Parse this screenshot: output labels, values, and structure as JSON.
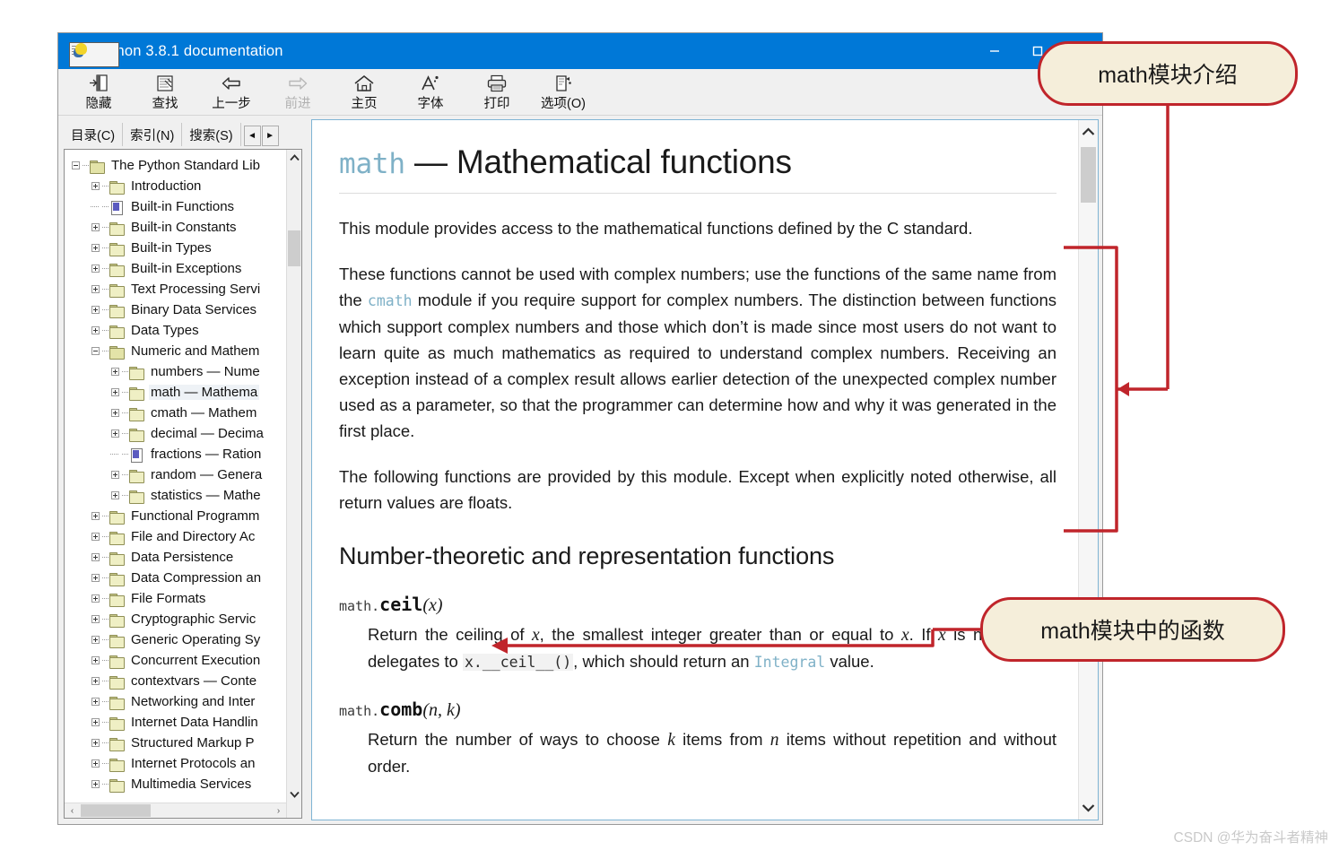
{
  "window": {
    "title": "Python 3.8.1 documentation",
    "icon": "chm-help-icon",
    "controls": {
      "minimize": "–",
      "maximize": "□"
    }
  },
  "toolbar": {
    "items": [
      {
        "label": "隐藏",
        "icon": "hide-pane-icon",
        "disabled": false
      },
      {
        "label": "查找",
        "icon": "search-icon",
        "disabled": false
      },
      {
        "label": "上一步",
        "icon": "back-arrow-icon",
        "disabled": false
      },
      {
        "label": "前进",
        "icon": "forward-arrow-icon",
        "disabled": true
      },
      {
        "label": "主页",
        "icon": "home-icon",
        "disabled": false
      },
      {
        "label": "字体",
        "icon": "font-icon",
        "disabled": false
      },
      {
        "label": "打印",
        "icon": "print-icon",
        "disabled": false
      },
      {
        "label": "选项(O)",
        "icon": "options-icon",
        "disabled": false
      }
    ]
  },
  "sidebar": {
    "tabs": [
      {
        "label": "目录(C)",
        "active": true
      },
      {
        "label": "索引(N)",
        "active": false
      },
      {
        "label": "搜索(S)",
        "active": false
      }
    ],
    "nav_prev": "◄",
    "nav_next": "►",
    "hscroll_prev": "‹",
    "hscroll_next": "›",
    "tree": [
      {
        "label": "The Python Standard Lib",
        "depth": 0,
        "icon": "folder-open-icon",
        "expander": "minus",
        "selected": false
      },
      {
        "label": "Introduction",
        "depth": 1,
        "icon": "folder-icon",
        "expander": "plus",
        "selected": false
      },
      {
        "label": "Built-in Functions",
        "depth": 1,
        "icon": "page-icon",
        "expander": "none",
        "selected": false
      },
      {
        "label": "Built-in Constants",
        "depth": 1,
        "icon": "folder-icon",
        "expander": "plus",
        "selected": false
      },
      {
        "label": "Built-in Types",
        "depth": 1,
        "icon": "folder-icon",
        "expander": "plus",
        "selected": false
      },
      {
        "label": "Built-in Exceptions",
        "depth": 1,
        "icon": "folder-icon",
        "expander": "plus",
        "selected": false
      },
      {
        "label": "Text Processing Servi",
        "depth": 1,
        "icon": "folder-icon",
        "expander": "plus",
        "selected": false
      },
      {
        "label": "Binary Data Services",
        "depth": 1,
        "icon": "folder-icon",
        "expander": "plus",
        "selected": false
      },
      {
        "label": "Data Types",
        "depth": 1,
        "icon": "folder-icon",
        "expander": "plus",
        "selected": false
      },
      {
        "label": "Numeric and Mathem",
        "depth": 1,
        "icon": "folder-open-icon",
        "expander": "minus",
        "selected": false
      },
      {
        "label": "numbers — Nume",
        "depth": 2,
        "icon": "folder-icon",
        "expander": "plus",
        "selected": false
      },
      {
        "label": "math — Mathema",
        "depth": 2,
        "icon": "folder-icon",
        "expander": "plus",
        "selected": true
      },
      {
        "label": "cmath — Mathem",
        "depth": 2,
        "icon": "folder-icon",
        "expander": "plus",
        "selected": false
      },
      {
        "label": "decimal — Decima",
        "depth": 2,
        "icon": "folder-icon",
        "expander": "plus",
        "selected": false
      },
      {
        "label": "fractions — Ration",
        "depth": 2,
        "icon": "page-icon",
        "expander": "none",
        "selected": false
      },
      {
        "label": "random — Genera",
        "depth": 2,
        "icon": "folder-icon",
        "expander": "plus",
        "selected": false
      },
      {
        "label": "statistics — Mathe",
        "depth": 2,
        "icon": "folder-icon",
        "expander": "plus",
        "selected": false
      },
      {
        "label": "Functional Programm",
        "depth": 1,
        "icon": "folder-icon",
        "expander": "plus",
        "selected": false
      },
      {
        "label": "File and Directory Ac",
        "depth": 1,
        "icon": "folder-icon",
        "expander": "plus",
        "selected": false
      },
      {
        "label": "Data Persistence",
        "depth": 1,
        "icon": "folder-icon",
        "expander": "plus",
        "selected": false
      },
      {
        "label": "Data Compression an",
        "depth": 1,
        "icon": "folder-icon",
        "expander": "plus",
        "selected": false
      },
      {
        "label": "File Formats",
        "depth": 1,
        "icon": "folder-icon",
        "expander": "plus",
        "selected": false
      },
      {
        "label": "Cryptographic Servic",
        "depth": 1,
        "icon": "folder-icon",
        "expander": "plus",
        "selected": false
      },
      {
        "label": "Generic Operating Sy",
        "depth": 1,
        "icon": "folder-icon",
        "expander": "plus",
        "selected": false
      },
      {
        "label": "Concurrent Execution",
        "depth": 1,
        "icon": "folder-icon",
        "expander": "plus",
        "selected": false
      },
      {
        "label": "contextvars — Conte",
        "depth": 1,
        "icon": "folder-icon",
        "expander": "plus",
        "selected": false
      },
      {
        "label": "Networking and Inter",
        "depth": 1,
        "icon": "folder-icon",
        "expander": "plus",
        "selected": false
      },
      {
        "label": "Internet Data Handlin",
        "depth": 1,
        "icon": "folder-icon",
        "expander": "plus",
        "selected": false
      },
      {
        "label": "Structured Markup P",
        "depth": 1,
        "icon": "folder-icon",
        "expander": "plus",
        "selected": false
      },
      {
        "label": "Internet Protocols an",
        "depth": 1,
        "icon": "folder-icon",
        "expander": "plus",
        "selected": false
      },
      {
        "label": "Multimedia Services",
        "depth": 1,
        "icon": "folder-icon",
        "expander": "plus",
        "selected": false
      }
    ]
  },
  "document": {
    "title_code": "math",
    "title_rest": " — Mathematical functions",
    "para1": "This module provides access to the mathematical functions defined by the C standard.",
    "para2_a": "These functions cannot be used with complex numbers; use the functions of the same name from the ",
    "para2_code": "cmath",
    "para2_b": " module if you require support for complex numbers. The distinction between functions which support complex numbers and those which don’t is made since most users do not want to learn quite as much mathematics as required to understand complex numbers. Receiving an exception instead of a complex result allows earlier detection of the unexpected complex number used as a parameter, so that the programmer can determine how and why it was generated in the first place.",
    "para3": "The following functions are provided by this module. Except when explicitly noted otherwise, all return values are floats.",
    "section_title": "Number-theoretic and representation functions",
    "functions": [
      {
        "prefix": "math.",
        "name": "ceil",
        "args": "(x)",
        "desc_a": "Return the ceiling of ",
        "desc_arg1": "x",
        "desc_b": ", the smallest integer greater than or equal to ",
        "desc_arg2": "x",
        "desc_c": ". If ",
        "desc_arg3": "x",
        "desc_d": " is not a float, delegates to ",
        "desc_code": "x.__ceil__()",
        "desc_e": ", which should return an ",
        "desc_link": "Integral",
        "desc_f": " value."
      },
      {
        "prefix": "math.",
        "name": "comb",
        "args": "(n, k)",
        "desc_a": "Return the number of ways to choose ",
        "desc_arg1": "k",
        "desc_b": " items from ",
        "desc_arg2": "n",
        "desc_c": " items without repetition and without order."
      }
    ]
  },
  "annotations": {
    "callout_intro": "math模块介绍",
    "callout_functions": "math模块中的函数",
    "accent_color": "#c0252b",
    "callout_fill": "#f5eeda"
  },
  "watermark": "CSDN @华为奋斗者精神"
}
